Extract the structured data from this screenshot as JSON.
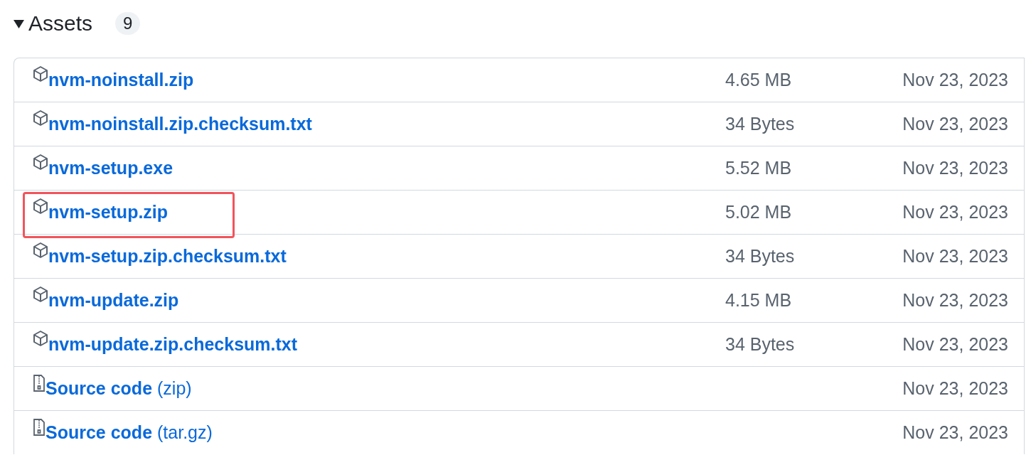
{
  "section": {
    "title": "Assets",
    "expanded": true,
    "count": "9"
  },
  "assets": [
    {
      "kind": "file",
      "name": "nvm-noinstall.zip",
      "size": "4.65 MB",
      "date": "Nov 23, 2023",
      "highlighted": false
    },
    {
      "kind": "file",
      "name": "nvm-noinstall.zip.checksum.txt",
      "size": "34 Bytes",
      "date": "Nov 23, 2023",
      "highlighted": false
    },
    {
      "kind": "file",
      "name": "nvm-setup.exe",
      "size": "5.52 MB",
      "date": "Nov 23, 2023",
      "highlighted": false
    },
    {
      "kind": "file",
      "name": "nvm-setup.zip",
      "size": "5.02 MB",
      "date": "Nov 23, 2023",
      "highlighted": true
    },
    {
      "kind": "file",
      "name": "nvm-setup.zip.checksum.txt",
      "size": "34 Bytes",
      "date": "Nov 23, 2023",
      "highlighted": false
    },
    {
      "kind": "file",
      "name": "nvm-update.zip",
      "size": "4.15 MB",
      "date": "Nov 23, 2023",
      "highlighted": false
    },
    {
      "kind": "file",
      "name": "nvm-update.zip.checksum.txt",
      "size": "34 Bytes",
      "date": "Nov 23, 2023",
      "highlighted": false
    },
    {
      "kind": "source",
      "name": "**Source code** (zip)",
      "date": "Nov 23, 2023",
      "highlighted": false
    },
    {
      "kind": "source",
      "name": "**Source code** (tar.gz)",
      "date": "Nov 23, 2023",
      "highlighted": false
    }
  ]
}
